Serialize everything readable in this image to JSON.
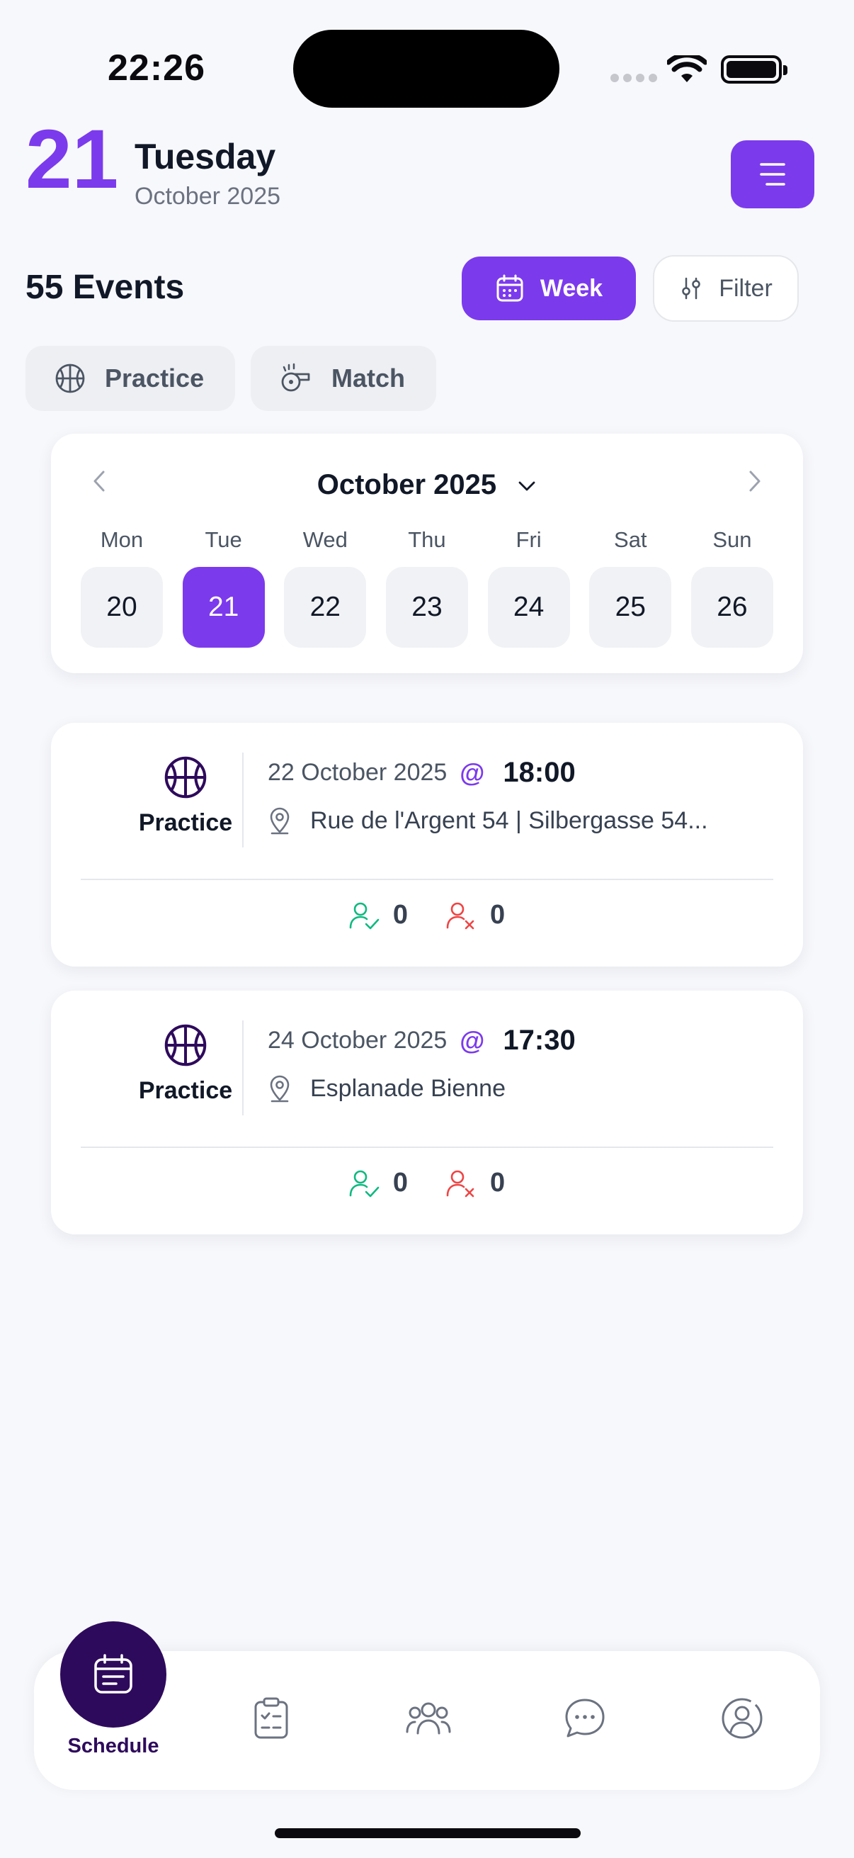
{
  "status_bar": {
    "time": "22:26"
  },
  "header": {
    "day_number": "21",
    "weekday": "Tuesday",
    "month_year": "October 2025",
    "menu_icon": "menu-icon"
  },
  "toolbar": {
    "events_count": "55 Events",
    "week_label": "Week",
    "filter_label": "Filter"
  },
  "type_filters": [
    {
      "label": "Practice",
      "icon": "basketball-icon"
    },
    {
      "label": "Match",
      "icon": "whistle-icon"
    }
  ],
  "calendar": {
    "month_label": "October 2025",
    "days": [
      {
        "name": "Mon",
        "num": "20",
        "selected": false
      },
      {
        "name": "Tue",
        "num": "21",
        "selected": true
      },
      {
        "name": "Wed",
        "num": "22",
        "selected": false
      },
      {
        "name": "Thu",
        "num": "23",
        "selected": false
      },
      {
        "name": "Fri",
        "num": "24",
        "selected": false
      },
      {
        "name": "Sat",
        "num": "25",
        "selected": false
      },
      {
        "name": "Sun",
        "num": "26",
        "selected": false
      }
    ]
  },
  "events": [
    {
      "type": "Practice",
      "date": "22 October 2025",
      "at": "@",
      "time": "18:00",
      "location": "Rue de l'Argent 54 | Silbergasse 54...",
      "attending": "0",
      "declined": "0"
    },
    {
      "type": "Practice",
      "date": "24 October 2025",
      "at": "@",
      "time": "17:30",
      "location": "Esplanade Bienne",
      "attending": "0",
      "declined": "0"
    }
  ],
  "bottom_nav": {
    "active_label": "Schedule",
    "items": [
      "calendar-icon",
      "checklist-icon",
      "team-icon",
      "chat-icon",
      "profile-icon"
    ]
  },
  "colors": {
    "accent": "#7c3aed",
    "nav_dark": "#2e0a5c",
    "attending": "#10b981",
    "declined": "#ef4444"
  }
}
